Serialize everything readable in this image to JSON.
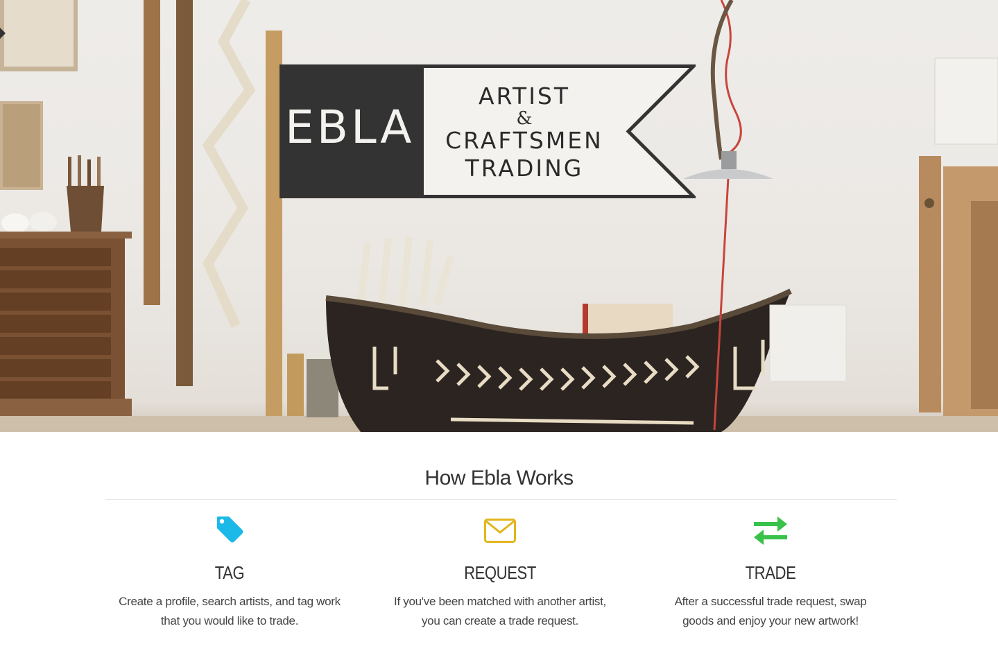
{
  "hero": {
    "logo": {
      "brand": "EBLA",
      "tagline_line1": "ARTIST",
      "tagline_amp": "&",
      "tagline_line2": "CRAFTSMEN",
      "tagline_line3": "TRADING"
    }
  },
  "how": {
    "title": "How Ebla Works",
    "steps": [
      {
        "icon": "tag-icon",
        "color": "#1bb9e8",
        "title": "TAG",
        "text": "Create a profile, search artists, and tag work that you would like to trade."
      },
      {
        "icon": "envelope-icon",
        "color": "#e2b51c",
        "title": "REQUEST",
        "text": "If you've been matched with another artist, you can create a trade request."
      },
      {
        "icon": "exchange-arrows-icon",
        "color": "#38c24a",
        "title": "TRADE",
        "text": "After a successful trade request, swap goods and enjoy your new artwork!"
      }
    ]
  }
}
